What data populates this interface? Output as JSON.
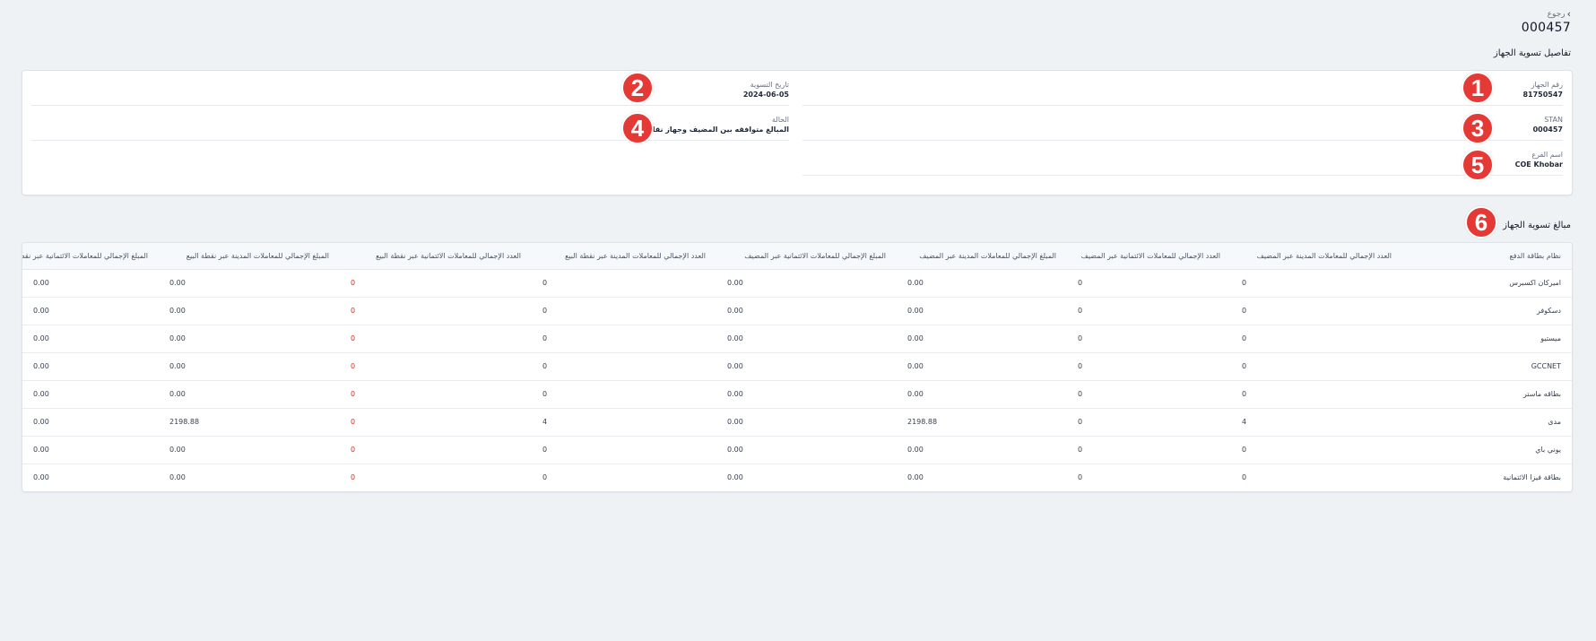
{
  "header": {
    "back_label": "رجوع",
    "back_icon": "chevron-left-icon",
    "page_title": "000457"
  },
  "details": {
    "section_title": "تفاصيل تسوية الجهاز",
    "fields": [
      {
        "label": "رقم الجهاز",
        "value": "81750547"
      },
      {
        "label": "تاريخ التسوية",
        "value": "2024-06-05"
      },
      {
        "label": "STAN",
        "value": "000457"
      },
      {
        "label": "الحالة",
        "value": "المبالغ متوافقه بين المضيف وجهاز نقاط البيع"
      },
      {
        "label": "اسم الفرع",
        "value": "COE Khobar"
      }
    ]
  },
  "badges": [
    "1",
    "2",
    "3",
    "4",
    "5",
    "6"
  ],
  "badge_color": "#e53935",
  "amounts": {
    "section_title": "مبالغ تسوية الجهاز",
    "columns": [
      "نظام بطاقة الدفع",
      "العدد الإجمالي للمعاملات المدينة عبر المضيف",
      "العدد الإجمالي للمعاملات الائتمانية عبر المضيف",
      "المبلغ الإجمالي للمعاملات المدينة عبر المضيف",
      "المبلغ الإجمالي للمعاملات الائتمانية عبر المضيف",
      "العدد الإجمالي للمعاملات المدينة عبر نقطة البيع",
      "العدد الإجمالي للمعاملات الائتمانية عبر نقطة البيع",
      "المبلغ الإجمالي للمعاملات المدينة عبر نقطة البيع",
      "المبلغ الإجمالي للمعاملات الائتمانية عبر نقطة البيع"
    ],
    "rows": [
      [
        "اميركان اكسبرس",
        "0",
        "0",
        "0.00",
        "0.00",
        "0",
        "0",
        "0.00",
        "0.00"
      ],
      [
        "دسكوفر",
        "0",
        "0",
        "0.00",
        "0.00",
        "0",
        "0",
        "0.00",
        "0.00"
      ],
      [
        "ميستيو",
        "0",
        "0",
        "0.00",
        "0.00",
        "0",
        "0",
        "0.00",
        "0.00"
      ],
      [
        "GCCNET",
        "0",
        "0",
        "0.00",
        "0.00",
        "0",
        "0",
        "0.00",
        "0.00"
      ],
      [
        "بطاقه ماستر",
        "0",
        "0",
        "0.00",
        "0.00",
        "0",
        "0",
        "0.00",
        "0.00"
      ],
      [
        "مدى",
        "4",
        "0",
        "2198.88",
        "0.00",
        "4",
        "0",
        "2198.88",
        "0.00"
      ],
      [
        "يوني باي",
        "0",
        "0",
        "0.00",
        "0.00",
        "0",
        "0",
        "0.00",
        "0.00"
      ],
      [
        "بطاقة فيزا الائتمانية",
        "0",
        "0",
        "0.00",
        "0.00",
        "0",
        "0",
        "0.00",
        "0.00"
      ]
    ]
  }
}
